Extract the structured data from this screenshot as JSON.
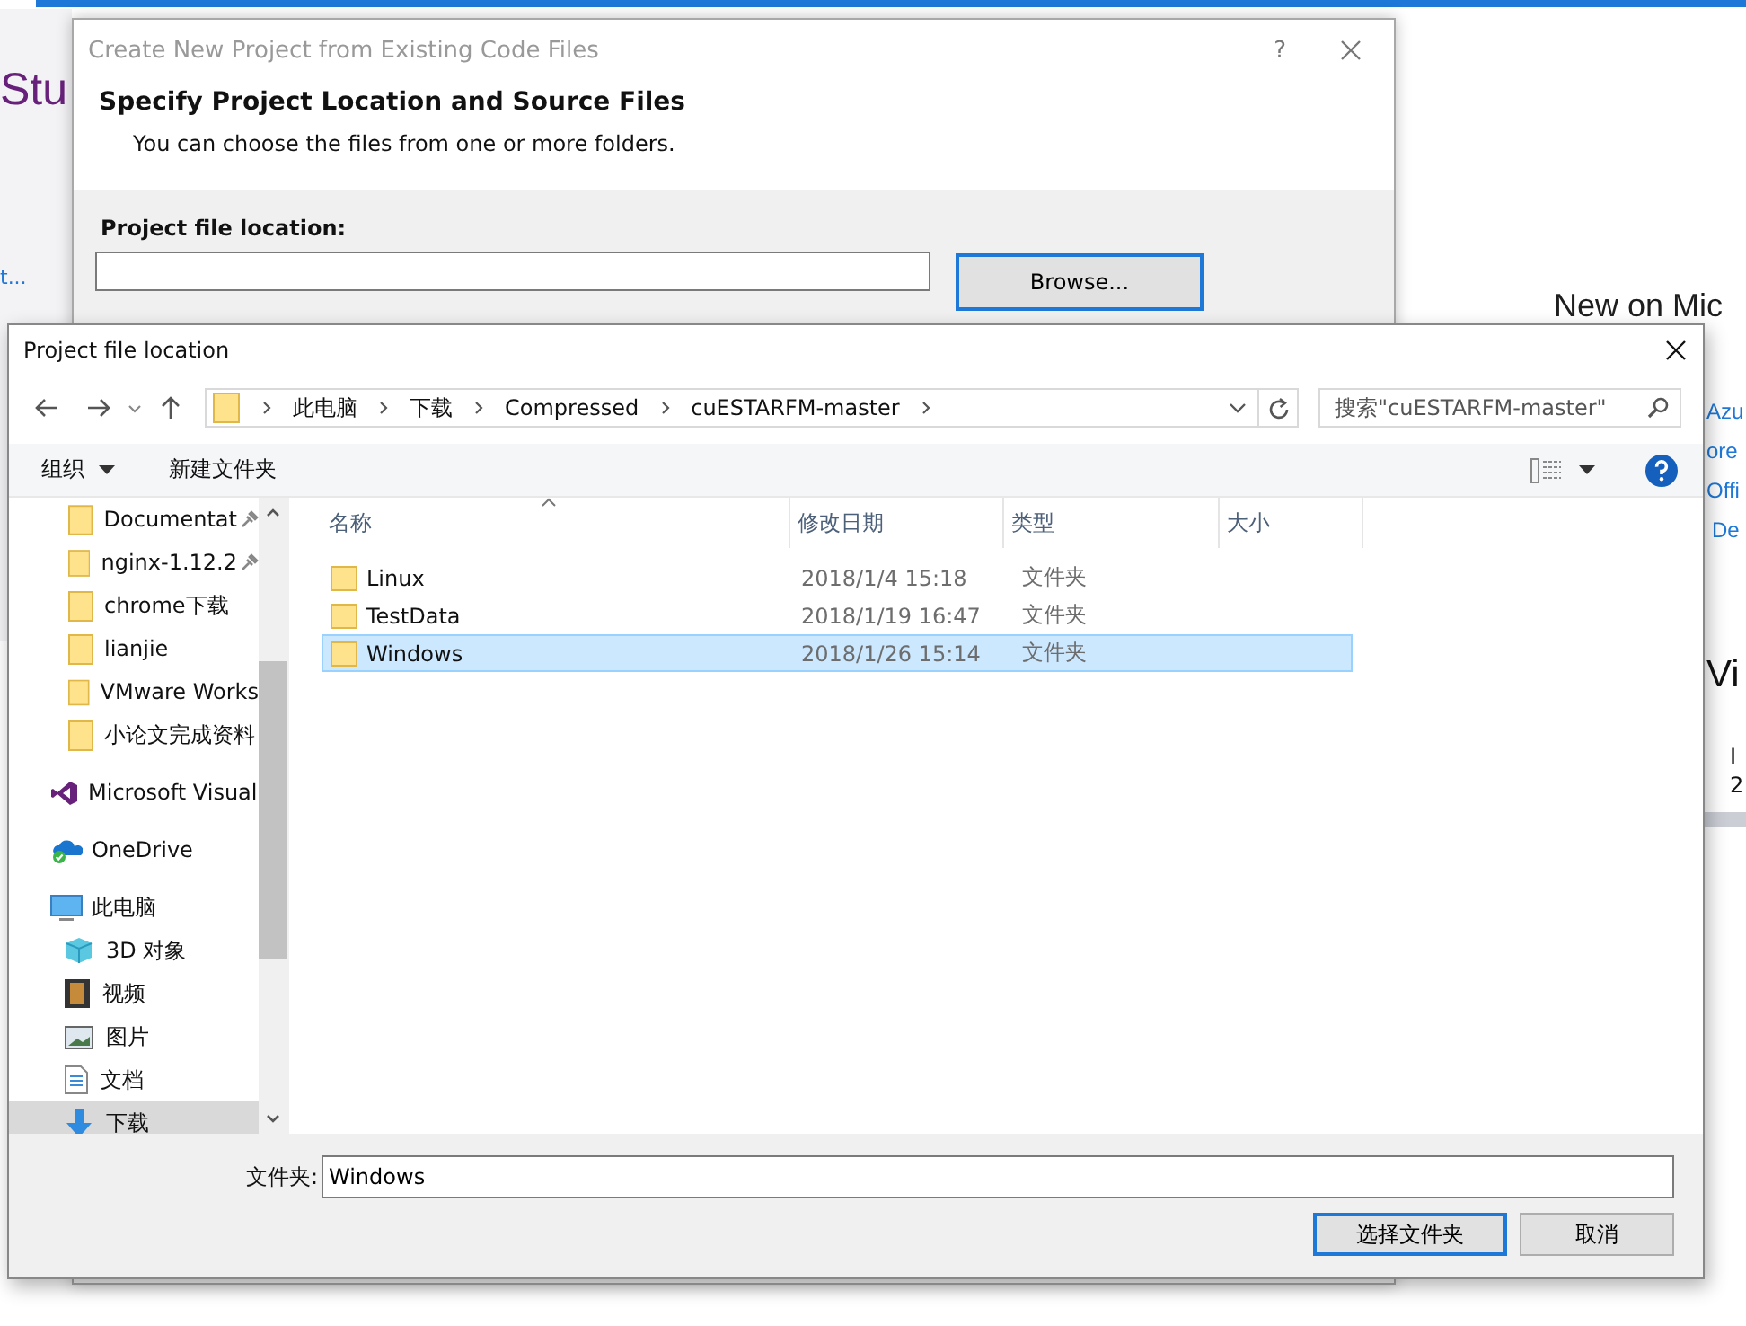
{
  "background": {
    "title_fragment": "Stu",
    "link_fragment": "t...",
    "news_heading": "New on Mic",
    "news_links": [
      "Azu",
      "ore",
      "Offi",
      "De"
    ],
    "video_heading": "Vi",
    "video_items": [
      "I",
      "2"
    ]
  },
  "project_dialog": {
    "title": "Create New Project from Existing Code Files",
    "help": "?",
    "heading": "Specify Project Location and Source Files",
    "subheading": "You can choose the files from one or more folders.",
    "location_label": "Project file location:",
    "browse": "Browse..."
  },
  "folder_dialog": {
    "title": "Project file location",
    "breadcrumbs": [
      "此电脑",
      "下载",
      "Compressed",
      "cuESTARFM-master"
    ],
    "search": {
      "placeholder": "搜索\"cuESTARFM-master\""
    },
    "toolbar": {
      "organize": "组织",
      "new_folder": "新建文件夹"
    },
    "quick_access": [
      {
        "label": "Documentat",
        "kind": "folder",
        "pinned": true,
        "selected": false
      },
      {
        "label": "nginx-1.12.2",
        "kind": "folder",
        "pinned": true,
        "selected": false
      },
      {
        "label": "chrome下载",
        "kind": "folder",
        "pinned": false,
        "selected": false
      },
      {
        "label": "lianjie",
        "kind": "folder",
        "pinned": false,
        "selected": false
      },
      {
        "label": "VMware Works",
        "kind": "folder",
        "pinned": false,
        "selected": false
      },
      {
        "label": "小论文完成资料",
        "kind": "folder",
        "pinned": false,
        "selected": false
      }
    ],
    "places": [
      {
        "label": "Microsoft Visual",
        "kind": "vs",
        "selected": false
      },
      {
        "label": "OneDrive",
        "kind": "onedrive",
        "selected": false
      },
      {
        "label": "此电脑",
        "kind": "pc",
        "selected": false,
        "children": [
          {
            "label": "3D 对象",
            "kind": "cube",
            "selected": false
          },
          {
            "label": "视频",
            "kind": "video",
            "selected": false
          },
          {
            "label": "图片",
            "kind": "picture",
            "selected": false
          },
          {
            "label": "文档",
            "kind": "document",
            "selected": false
          },
          {
            "label": "下载",
            "kind": "download",
            "selected": true
          }
        ]
      }
    ],
    "columns": [
      "名称",
      "修改日期",
      "类型",
      "大小"
    ],
    "files": [
      {
        "name": "Linux",
        "modified": "2018/1/4 15:18",
        "type": "文件夹",
        "selected": false
      },
      {
        "name": "TestData",
        "modified": "2018/1/19 16:47",
        "type": "文件夹",
        "selected": false
      },
      {
        "name": "Windows",
        "modified": "2018/1/26 15:14",
        "type": "文件夹",
        "selected": true
      }
    ],
    "folder_label": "文件夹:",
    "folder_value": "Windows",
    "buttons": [
      {
        "label": "选择文件夹",
        "default": true
      },
      {
        "label": "取消",
        "default": false
      }
    ]
  }
}
